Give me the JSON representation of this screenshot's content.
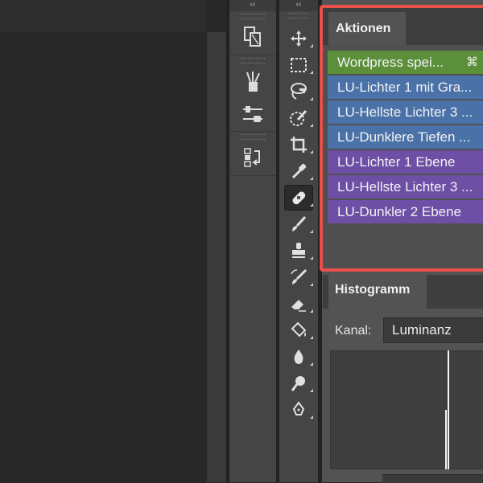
{
  "panels": {
    "collapse_left": "‹‹",
    "collapse_right": "‹‹"
  },
  "colors": {
    "green": "#5b8f3a",
    "blue": "#4b72a8",
    "purple": "#6e4fa6",
    "highlight": "#e8504a"
  },
  "tools": [
    {
      "name": "move-tool",
      "icon": "move-icon"
    },
    {
      "name": "marquee-tool",
      "icon": "marquee-icon"
    },
    {
      "name": "lasso-tool",
      "icon": "magnetic-lasso-icon"
    },
    {
      "name": "quick-selection-tool",
      "icon": "quick-selection-icon"
    },
    {
      "name": "crop-tool",
      "icon": "crop-icon"
    },
    {
      "name": "eyedropper-tool",
      "icon": "eyedropper-icon"
    },
    {
      "name": "healing-brush-tool",
      "icon": "bandage-icon",
      "active": true
    },
    {
      "name": "brush-tool",
      "icon": "brush-icon"
    },
    {
      "name": "stamp-tool",
      "icon": "stamp-icon"
    },
    {
      "name": "history-brush-tool",
      "icon": "history-brush-icon"
    },
    {
      "name": "eraser-tool",
      "icon": "eraser-icon"
    },
    {
      "name": "paint-bucket-tool",
      "icon": "paint-bucket-icon"
    },
    {
      "name": "blur-tool",
      "icon": "drop-icon"
    },
    {
      "name": "dodge-tool",
      "icon": "dodge-icon"
    },
    {
      "name": "pen-tool",
      "icon": "pen-icon"
    }
  ],
  "actions_panel": {
    "tab_label": "Aktionen",
    "items": [
      {
        "label": "Wordpress spei...",
        "shortcut": "⌘",
        "color": "#5b8f3a"
      },
      {
        "label": "LU-Lichter 1 mit Gra...",
        "shortcut": "",
        "color": "#4b72a8"
      },
      {
        "label": "LU-Hellste Lichter 3 ...",
        "shortcut": "",
        "color": "#4b72a8"
      },
      {
        "label": "LU-Dunklere Tiefen ...",
        "shortcut": "",
        "color": "#4b72a8"
      },
      {
        "label": "LU-Lichter 1 Ebene",
        "shortcut": "",
        "color": "#6e4fa6"
      },
      {
        "label": "LU-Hellste Lichter 3 ...",
        "shortcut": "",
        "color": "#6e4fa6"
      },
      {
        "label": "LU-Dunkler 2 Ebene",
        "shortcut": "",
        "color": "#6e4fa6"
      }
    ]
  },
  "histogram_panel": {
    "tab_label": "Histogramm",
    "channel_label": "Kanal:",
    "channel_value": "Luminanz"
  }
}
